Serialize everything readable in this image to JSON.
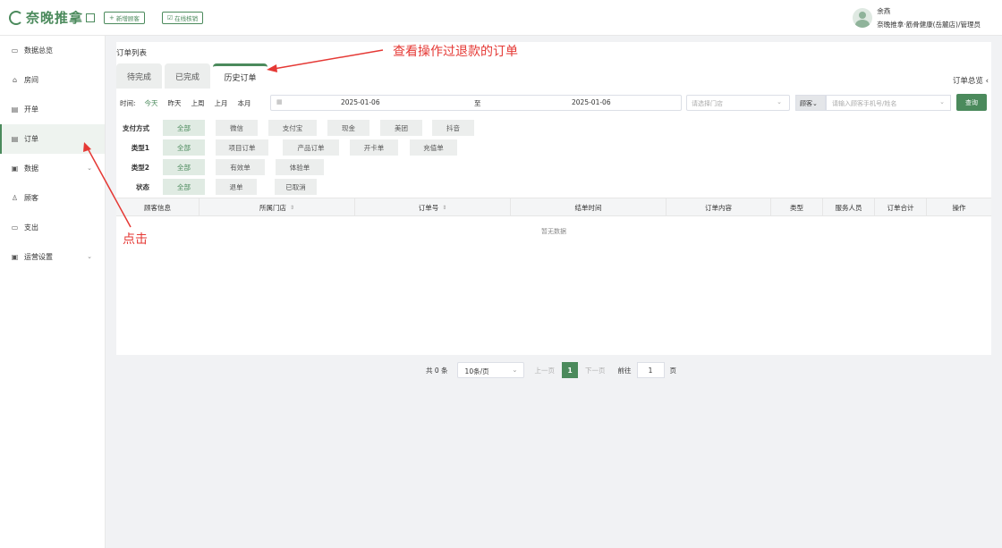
{
  "header": {
    "logo_text": "奈晚推拿",
    "new_customer_btn": "新增顾客",
    "online_verify_btn": "在线核销",
    "user_name": "余燕",
    "user_org": "奈晚推拿·筋骨健康(岳麓店)/管理员"
  },
  "sidebar": {
    "items": [
      {
        "label": "数据总览",
        "icon": "monitor-icon"
      },
      {
        "label": "房间",
        "icon": "home-icon"
      },
      {
        "label": "开单",
        "icon": "document-icon"
      },
      {
        "label": "订单",
        "icon": "order-icon"
      },
      {
        "label": "数据",
        "icon": "data-icon"
      },
      {
        "label": "顾客",
        "icon": "user-icon"
      },
      {
        "label": "支出",
        "icon": "wallet-icon"
      },
      {
        "label": "运营设置",
        "icon": "settings-icon"
      }
    ]
  },
  "main": {
    "title": "订单列表",
    "tabs": [
      "待完成",
      "已完成",
      "历史订单"
    ],
    "summary": "订单总览",
    "time": {
      "label": "时间:",
      "quick": [
        "今天",
        "昨天",
        "上周",
        "上月",
        "本月"
      ],
      "start": "2025-01-06",
      "to": "至",
      "end": "2025-01-06"
    },
    "store_placeholder": "请选择门店",
    "customer_type": "顾客",
    "customer_placeholder": "请输入顾客手机号/姓名",
    "query_btn": "查询",
    "filters": {
      "pay": {
        "label": "支付方式",
        "options": [
          "全部",
          "微信",
          "支付宝",
          "现金",
          "美团",
          "抖音"
        ]
      },
      "type1": {
        "label": "类型1",
        "options": [
          "全部",
          "项目订单",
          "产品订单",
          "开卡单",
          "充值单"
        ]
      },
      "type2": {
        "label": "类型2",
        "options": [
          "全部",
          "有效单",
          "体验单"
        ]
      },
      "status": {
        "label": "状态",
        "options": [
          "全部",
          "退单",
          "已取消"
        ]
      }
    },
    "table": {
      "columns": [
        "顾客信息",
        "所属门店",
        "订单号",
        "结单时间",
        "订单内容",
        "类型",
        "服务人员",
        "订单合计",
        "操作"
      ],
      "empty_text": "暂无数据"
    },
    "pagination": {
      "total": "共 0 条",
      "page_size": "10条/页",
      "prev": "上一页",
      "current": "1",
      "next": "下一页",
      "goto_label": "前往",
      "goto_value": "1",
      "page_unit": "页"
    }
  },
  "annotations": {
    "history_note": "查看操作过退款的订单",
    "click_note": "点击"
  },
  "colors": {
    "brand_green": "#4b8a5c",
    "annotation_red": "#e53935"
  }
}
